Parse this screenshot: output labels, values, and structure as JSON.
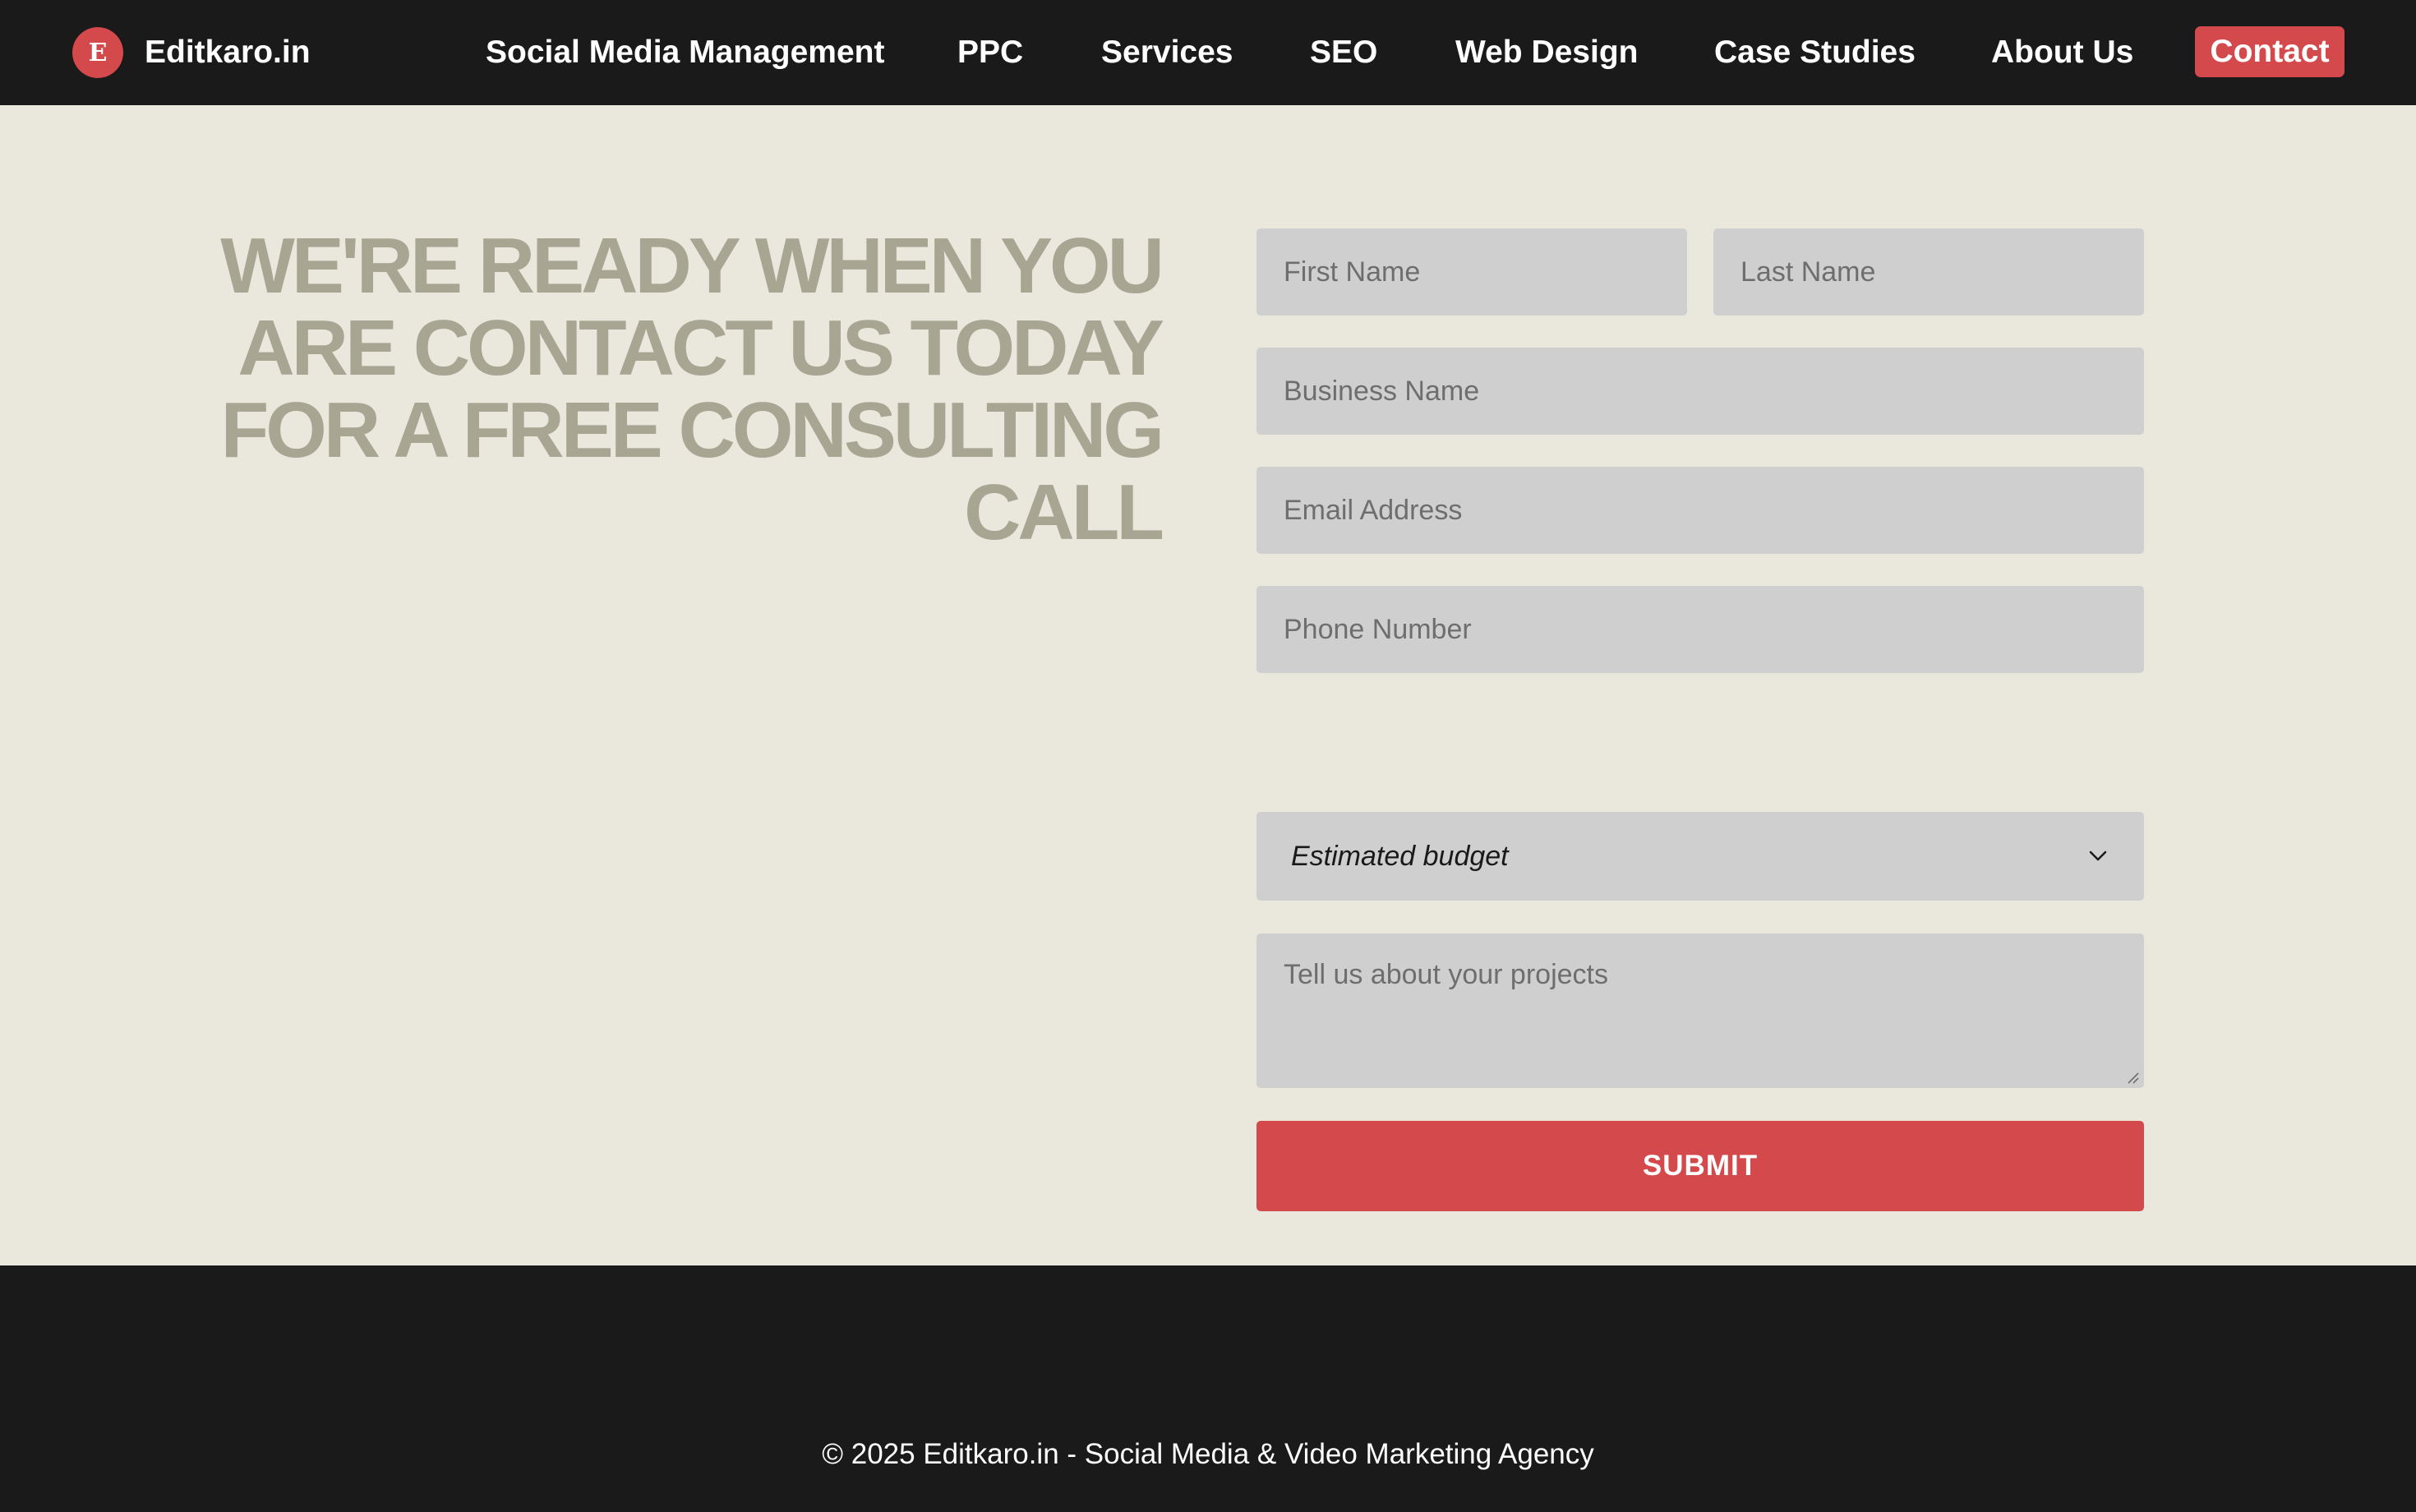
{
  "header": {
    "brand": {
      "logo_letter": "E",
      "name": "Editkaro.in"
    },
    "nav": [
      {
        "label": "Social Media Management"
      },
      {
        "label": "PPC"
      },
      {
        "label": "Services"
      },
      {
        "label": "SEO"
      },
      {
        "label": "Web Design"
      },
      {
        "label": "Case Studies"
      },
      {
        "label": "About Us"
      }
    ],
    "cta_label": "Contact"
  },
  "main": {
    "headline": "WE'RE READY WHEN YOU ARE CONTACT US TODAY FOR A FREE CONSULTING CALL",
    "form": {
      "first_name_placeholder": "First Name",
      "last_name_placeholder": "Last Name",
      "business_name_placeholder": "Business Name",
      "email_placeholder": "Email Address",
      "phone_placeholder": "Phone Number",
      "budget_selected": "Estimated budget",
      "projects_placeholder": "Tell us about your projects",
      "submit_label": "SUBMIT"
    }
  },
  "footer": {
    "copyright": "© 2025 Editkaro.in - Social Media & Video Marketing Agency"
  },
  "icons": {
    "budget_dropdown": "chevron-down-icon",
    "textarea_resize": "resize-handle-icon"
  },
  "colors": {
    "nav_background": "#1a1a1a",
    "accent": "#d4494c",
    "page_background": "#eae8dd",
    "headline": "#a9a593",
    "field_background": "#cfcfcf"
  }
}
